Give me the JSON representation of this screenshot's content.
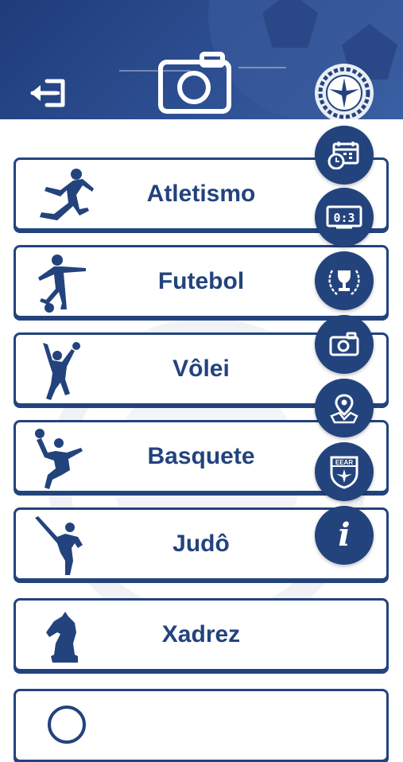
{
  "colors": {
    "primary": "#23437d",
    "header": "#2d4f92",
    "background": "#ffffff"
  },
  "header": {
    "back_icon": "back-icon",
    "camera_icon": "camera-icon",
    "logo_icon": "eear-emblem-icon"
  },
  "sports": [
    {
      "label": "Atletismo",
      "icon": "runner-icon"
    },
    {
      "label": "Futebol",
      "icon": "soccer-player-icon"
    },
    {
      "label": "Vôlei",
      "icon": "volleyball-player-icon"
    },
    {
      "label": "Basquete",
      "icon": "basketball-player-icon"
    },
    {
      "label": "Judô",
      "icon": "judo-kick-icon"
    },
    {
      "label": "Xadrez",
      "icon": "chess-knight-icon"
    },
    {
      "label": "",
      "icon": "partial-item-icon"
    }
  ],
  "fab_menu": [
    {
      "icon": "calendar-clock-icon"
    },
    {
      "icon": "scoreboard-icon",
      "text": "0:3"
    },
    {
      "icon": "trophy-laurel-icon"
    },
    {
      "icon": "camera-icon"
    },
    {
      "icon": "map-location-icon"
    },
    {
      "icon": "eear-shield-icon",
      "text": "EEAR"
    },
    {
      "icon": "info-icon",
      "text": "i"
    }
  ]
}
